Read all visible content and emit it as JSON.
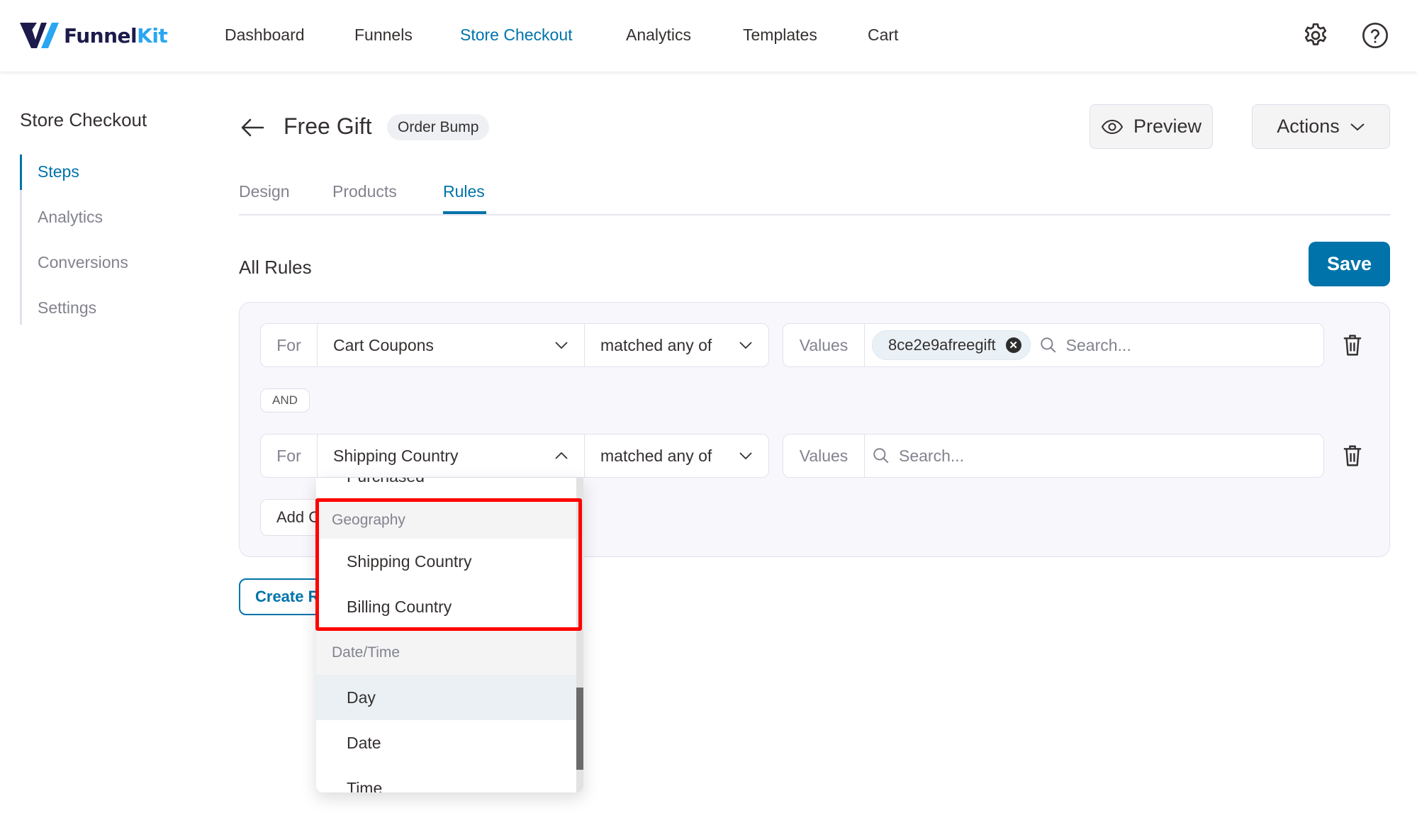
{
  "header": {
    "logo": {
      "brand_main": "Funnel",
      "brand_accent": "Kit"
    },
    "nav": [
      {
        "label": "Dashboard",
        "active": false
      },
      {
        "label": "Funnels",
        "active": false
      },
      {
        "label": "Store Checkout",
        "active": true
      },
      {
        "label": "Analytics",
        "active": false
      },
      {
        "label": "Templates",
        "active": false
      },
      {
        "label": "Cart",
        "active": false
      }
    ],
    "icons": [
      "gear-icon",
      "help-icon"
    ]
  },
  "sidebar": {
    "title": "Store Checkout",
    "items": [
      {
        "label": "Steps",
        "active": true
      },
      {
        "label": "Analytics",
        "active": false
      },
      {
        "label": "Conversions",
        "active": false
      },
      {
        "label": "Settings",
        "active": false
      }
    ]
  },
  "page": {
    "title": "Free Gift",
    "badge": "Order Bump",
    "preview_label": "Preview",
    "actions_label": "Actions",
    "tabs": [
      {
        "label": "Design",
        "active": false
      },
      {
        "label": "Products",
        "active": false
      },
      {
        "label": "Rules",
        "active": true
      }
    ]
  },
  "rules": {
    "section_title": "All Rules",
    "save_label": "Save",
    "conditions": [
      {
        "for_label": "For",
        "field": "Cart Coupons",
        "operator": "matched any of",
        "values_label": "Values",
        "chips": [
          "8ce2e9afreegift"
        ],
        "search_placeholder": "Search..."
      },
      {
        "for_label": "For",
        "field": "Shipping Country",
        "operator": "matched any of",
        "values_label": "Values",
        "chips": [],
        "search_placeholder": "Search..."
      }
    ],
    "joiner": "AND",
    "add_condition_label": "Add Condition",
    "create_rule_label": "Create Rule"
  },
  "dropdown": {
    "partial_item": "Purchased",
    "groups": [
      {
        "label": "Geography",
        "items": [
          "Shipping Country",
          "Billing Country"
        ]
      },
      {
        "label": "Date/Time",
        "items": [
          "Day",
          "Date",
          "Time"
        ]
      }
    ],
    "hovered_item": "Day",
    "highlight_color": "#ff0000"
  },
  "colors": {
    "accent": "#0073aa",
    "logo_dark": "#1d1b4b",
    "logo_light": "#2aa6f2",
    "highlight": "#ff0000"
  }
}
